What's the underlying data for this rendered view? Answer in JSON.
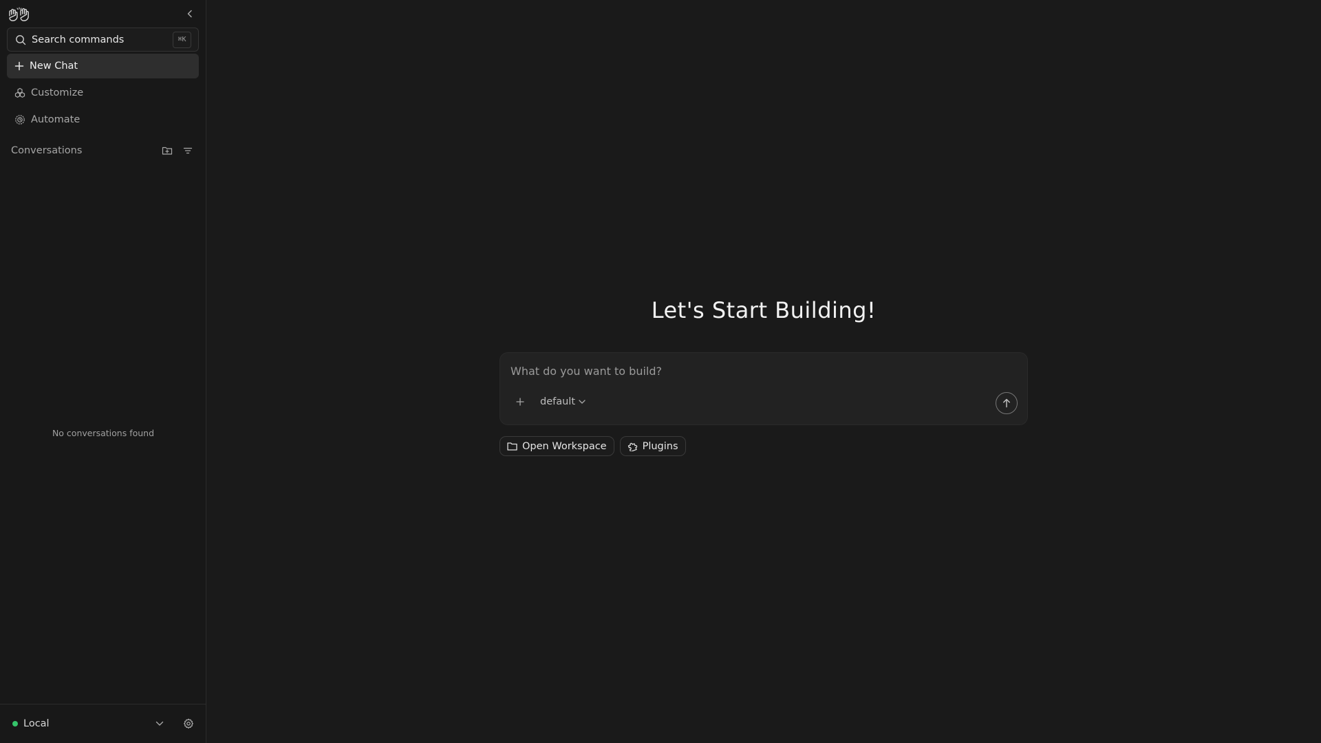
{
  "sidebar": {
    "logo_icon": "waving-hands-logo",
    "search": {
      "label": "Search commands",
      "shortcut": "⌘K"
    },
    "nav": {
      "new_chat": "New Chat",
      "customize": "Customize",
      "automate": "Automate"
    },
    "conversations": {
      "title": "Conversations",
      "empty_message": "No conversations found"
    },
    "footer": {
      "environment": "Local",
      "status_color": "#35c46a"
    }
  },
  "main": {
    "title": "Let's Start Building!",
    "composer": {
      "placeholder": "What do you want to build?",
      "value": "",
      "model": "default"
    },
    "chips": {
      "open_workspace": "Open Workspace",
      "plugins": "Plugins"
    }
  }
}
